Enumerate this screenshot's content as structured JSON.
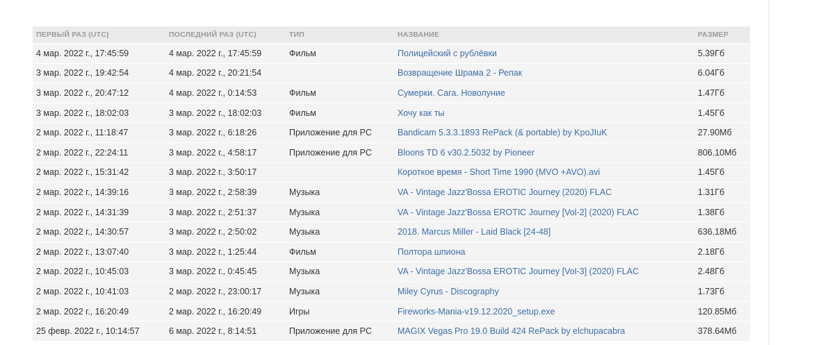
{
  "table": {
    "headers": {
      "first_seen": "ПЕРВЫЙ РАЗ (UTC)",
      "last_seen": "ПОСЛЕДНИЙ РАЗ (UTC)",
      "type": "ТИП",
      "name": "НАЗВАНИЕ",
      "size": "РАЗМЕР"
    },
    "rows": [
      {
        "first_seen": "4 мар. 2022 г., 17:45:59",
        "last_seen": "4 мар. 2022 г., 17:45:59",
        "type": "Фильм",
        "name": "Полицейский с рублёвки",
        "size": "5.39Гб"
      },
      {
        "first_seen": "3 мар. 2022 г., 19:42:54",
        "last_seen": "4 мар. 2022 г., 20:21:54",
        "type": "",
        "name": "Возвращение Шрама 2 - Репак",
        "size": "6.04Гб"
      },
      {
        "first_seen": "3 мар. 2022 г., 20:47:12",
        "last_seen": "4 мар. 2022 г., 0:14:53",
        "type": "Фильм",
        "name": "Сумерки. Сага. Новолуние",
        "size": "1.47Гб"
      },
      {
        "first_seen": "3 мар. 2022 г., 18:02:03",
        "last_seen": "3 мар. 2022 г., 18:02:03",
        "type": "Фильм",
        "name": "Хочу как ты",
        "size": "1.45Гб"
      },
      {
        "first_seen": "2 мар. 2022 г., 11:18:47",
        "last_seen": "3 мар. 2022 г., 6:18:26",
        "type": "Приложение для PC",
        "name": "Bandicam 5.3.3.1893 RePack (& portable) by KpoJIuK",
        "size": "27.90Мб"
      },
      {
        "first_seen": "2 мар. 2022 г., 22:24:11",
        "last_seen": "3 мар. 2022 г., 4:58:17",
        "type": "Приложение для PC",
        "name": "Bloons TD 6 v30.2.5032 by Pioneer",
        "size": "806.10Мб"
      },
      {
        "first_seen": "2 мар. 2022 г., 15:31:42",
        "last_seen": "3 мар. 2022 г., 3:50:17",
        "type": "",
        "name": "Короткое время - Short Time 1990 (MVO +AVO).avi",
        "size": "1.45Гб"
      },
      {
        "first_seen": "2 мар. 2022 г., 14:39:16",
        "last_seen": "3 мар. 2022 г., 2:58:39",
        "type": "Музыка",
        "name": "VA - Vintage Jazz'Bossa EROTIC Journey (2020) FLAC",
        "size": "1.31Гб"
      },
      {
        "first_seen": "2 мар. 2022 г., 14:31:39",
        "last_seen": "3 мар. 2022 г., 2:51:37",
        "type": "Музыка",
        "name": "VA - Vintage Jazz'Bossa EROTIC Journey [Vol-2] (2020) FLAC",
        "size": "1.38Гб"
      },
      {
        "first_seen": "2 мар. 2022 г., 14:30:57",
        "last_seen": "3 мар. 2022 г., 2:50:02",
        "type": "Музыка",
        "name": "2018. Marcus Miller - Laid Black [24-48]",
        "size": "636.18Мб"
      },
      {
        "first_seen": "2 мар. 2022 г., 13:07:40",
        "last_seen": "3 мар. 2022 г., 1:25:44",
        "type": "Фильм",
        "name": "Полтора шпиона",
        "size": "2.18Гб"
      },
      {
        "first_seen": "2 мар. 2022 г., 10:45:03",
        "last_seen": "3 мар. 2022 г., 0:45:45",
        "type": "Музыка",
        "name": "VA - Vintage Jazz'Bossa EROTIC Journey [Vol-3] (2020) FLAC",
        "size": "2.48Гб"
      },
      {
        "first_seen": "2 мар. 2022 г., 10:41:03",
        "last_seen": "2 мар. 2022 г., 23:00:17",
        "type": "Музыка",
        "name": "Miley Cyrus - Discography",
        "size": "1.73Гб"
      },
      {
        "first_seen": "2 мар. 2022 г., 16:20:49",
        "last_seen": "2 мар. 2022 г., 16:20:49",
        "type": "Игры",
        "name": "Fireworks-Mania-v19.12.2020_setup.exe",
        "size": "120.85Мб"
      },
      {
        "first_seen": "25 февр. 2022 г., 10:14:57",
        "last_seen": "6 мар. 2022 г., 8:14:51",
        "type": "Приложение для PC",
        "name": "MAGIX Vegas Pro 19.0 Build 424 RePack by elchupacabra",
        "size": "378.64Мб"
      }
    ]
  },
  "colors": {
    "link": "#3d6fa8",
    "header_bg": "#ebebeb",
    "row_bg": "#f4f4f4",
    "header_text": "#9a9a9a"
  }
}
